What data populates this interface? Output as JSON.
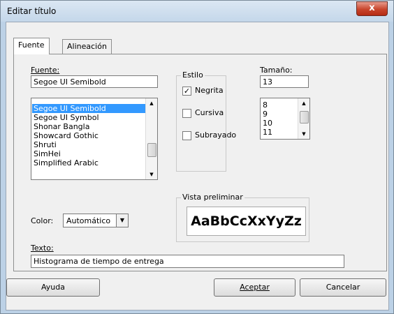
{
  "window": {
    "title": "Editar título",
    "close_glyph": "x"
  },
  "tabs": [
    {
      "label": "Fuente"
    },
    {
      "label": "Alineación"
    }
  ],
  "font": {
    "label": "Fuente:",
    "value": "Segoe UI Semibold",
    "list": [
      "Segoe UI Semibold",
      "Segoe UI Symbol",
      "Shonar Bangla",
      "Showcard Gothic",
      "Shruti",
      "SimHei",
      "Simplified Arabic"
    ]
  },
  "style": {
    "label": "Estilo",
    "bold": {
      "label": "Negrita",
      "checked": true
    },
    "italic": {
      "label": "Cursiva",
      "checked": false
    },
    "underline": {
      "label": "Subrayado",
      "checked": false
    }
  },
  "size": {
    "label": "Tamaño:",
    "value": "13",
    "list": [
      "8",
      "9",
      "10",
      "11"
    ]
  },
  "color": {
    "label": "Color:",
    "value": "Automático"
  },
  "preview": {
    "label": "Vista preliminar",
    "sample": "AaBbCcXxYyZz"
  },
  "text": {
    "label": "Texto:",
    "value": "Histograma de tiempo de entrega"
  },
  "buttons": {
    "help": "Ayuda",
    "ok": "Aceptar",
    "cancel": "Cancelar"
  },
  "colors": {
    "selection": "#3399ff",
    "dialog_bg": "#f0f0f0",
    "frame": "#bcd1e6"
  }
}
